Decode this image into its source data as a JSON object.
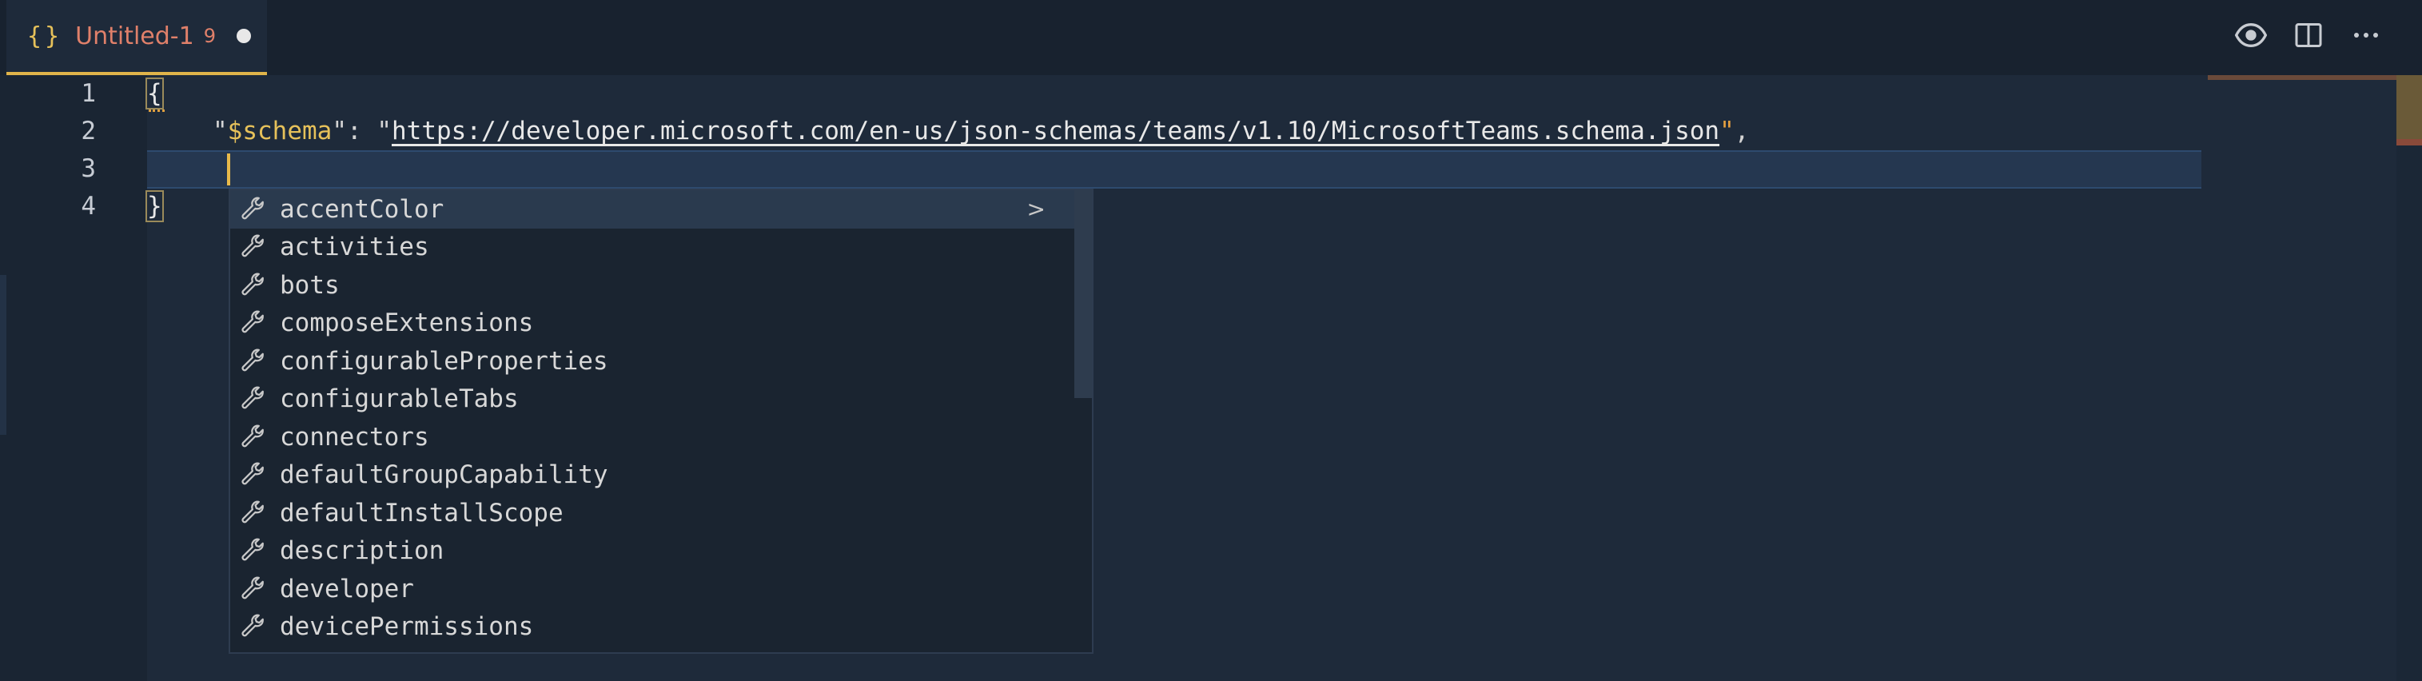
{
  "tab": {
    "icon_glyph": "{}",
    "title": "Untitled-1",
    "problem_count": "9"
  },
  "toolbar": {
    "icons": [
      "open-preview-icon",
      "split-editor-icon",
      "more-actions-icon"
    ]
  },
  "editor": {
    "line_numbers": [
      "1",
      "2",
      "3",
      "4"
    ],
    "line1": "{",
    "line2": {
      "open_quote": "\"",
      "key": "$schema",
      "close_quote": "\"",
      "colon": ": ",
      "value_open_quote": "\"",
      "value": "https://developer.microsoft.com/en-us/json-schemas/teams/v1.10/MicrosoftTeams.schema.json",
      "value_close_quote": "\"",
      "comma": ","
    },
    "line4": "}"
  },
  "suggest": {
    "items": [
      {
        "label": "accentColor",
        "icon": "property-wrench-icon"
      },
      {
        "label": "activities",
        "icon": "property-wrench-icon"
      },
      {
        "label": "bots",
        "icon": "property-wrench-icon"
      },
      {
        "label": "composeExtensions",
        "icon": "property-wrench-icon"
      },
      {
        "label": "configurableProperties",
        "icon": "property-wrench-icon"
      },
      {
        "label": "configurableTabs",
        "icon": "property-wrench-icon"
      },
      {
        "label": "connectors",
        "icon": "property-wrench-icon"
      },
      {
        "label": "defaultGroupCapability",
        "icon": "property-wrench-icon"
      },
      {
        "label": "defaultInstallScope",
        "icon": "property-wrench-icon"
      },
      {
        "label": "description",
        "icon": "property-wrench-icon"
      },
      {
        "label": "developer",
        "icon": "property-wrench-icon"
      },
      {
        "label": "devicePermissions",
        "icon": "property-wrench-icon"
      }
    ],
    "selected_index": 0,
    "more_glyph": ">"
  },
  "colors": {
    "accent": "#e0b44a",
    "key": "#e6c15a",
    "tab_title": "#e0806a",
    "background": "#1e2a3a"
  }
}
